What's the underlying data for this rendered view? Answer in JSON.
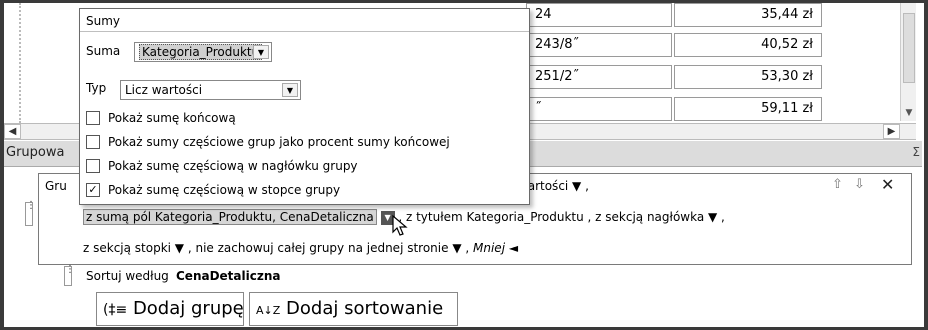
{
  "grid": {
    "rows": [
      {
        "dim": "24",
        "price": "35,44 zł"
      },
      {
        "dim": "243/8˝",
        "price": "40,52 zł"
      },
      {
        "dim": "251/2˝",
        "price": "53,30 zł"
      },
      {
        "dim": "˝",
        "price": "59,11 zł"
      }
    ]
  },
  "popup": {
    "title": "Sumy",
    "sum_label": "Suma",
    "sum_value": "Kategoria_Produktu",
    "type_label": "Typ",
    "type_value": "Licz wartości",
    "options": [
      {
        "label": "Pokaż sumę końcową",
        "checked": false
      },
      {
        "label": "Pokaż sumy częściowe grup jako procent sumy końcowej",
        "checked": false
      },
      {
        "label": "Pokaż sumę częściową w nagłówku grupy",
        "checked": false
      },
      {
        "label": "Pokaż sumę częściową w stopce grupy",
        "checked": true
      }
    ]
  },
  "pane": {
    "title": "Grupowa",
    "sigma": "Σ",
    "grp_prefix": "Gru",
    "line1_tail": "g całych wartości ▼ ,",
    "line2_field": "z sumą pól Kategoria_Produktu, CenaDetaliczna",
    "line2_rest": ", z tytułem Kategoria_Produktu , z sekcją nagłówka ▼ ,",
    "line3": "z sekcją stopki ▼ , nie zachowuj całej grupy na jednej stronie ▼ ,",
    "line3_less": "Mniej ◄",
    "sort_prefix": "Sortuj według",
    "sort_field": "CenaDetaliczna",
    "add_group": "Dodaj grupę",
    "add_sort": "Dodaj sortowanie",
    "add_group_icon": "(‡≡",
    "add_sort_icon": "A↓Z"
  }
}
